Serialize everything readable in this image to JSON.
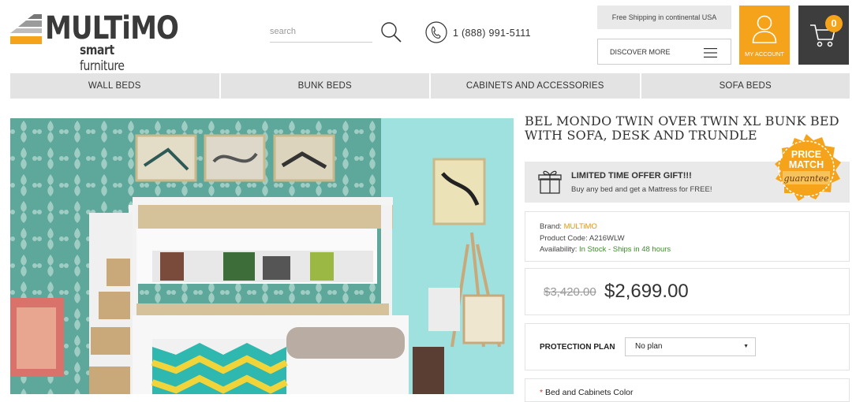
{
  "logo": {
    "word": "MULTiMO",
    "sub_bold": "smart",
    "sub_rest": " furniture"
  },
  "search": {
    "placeholder": "search"
  },
  "phone": "1 (888) 991-5111",
  "shipping": "Free Shipping in continental USA",
  "discover": "DISCOVER MORE",
  "account": "MY ACCOUNT",
  "cart": {
    "count": "0"
  },
  "nav": [
    "WALL BEDS",
    "BUNK BEDS",
    "CABINETS AND ACCESSORIES",
    "SOFA BEDS"
  ],
  "product": {
    "title": "BEL MONDO TWIN OVER TWIN XL BUNK BED WITH SOFA, DESK AND TRUNDLE",
    "gift_title": "LIMITED TIME OFFER GIFT!!!",
    "gift_sub": "Buy any bed and get a Mattress for FREE!",
    "badge_line1": "PRICE",
    "badge_line2": "MATCH",
    "badge_line3": "guarantee",
    "brand_label": "Brand: ",
    "brand": "MULTiMO",
    "code_label": "Product Code: ",
    "code": "A216WLW",
    "availability_label": "Availability: ",
    "availability": "In Stock - Ships in 48 hours",
    "old_price": "$3,420.00",
    "price": "$2,699.00",
    "protection_label": "PROTECTION PLAN",
    "protection_value": "No plan",
    "color_required": "*",
    "color_label": "Bed and Cabinets Color"
  },
  "colors": {
    "accent": "#f5a31a",
    "dark": "#3d3d3d",
    "in_stock": "#3f8a2c"
  }
}
